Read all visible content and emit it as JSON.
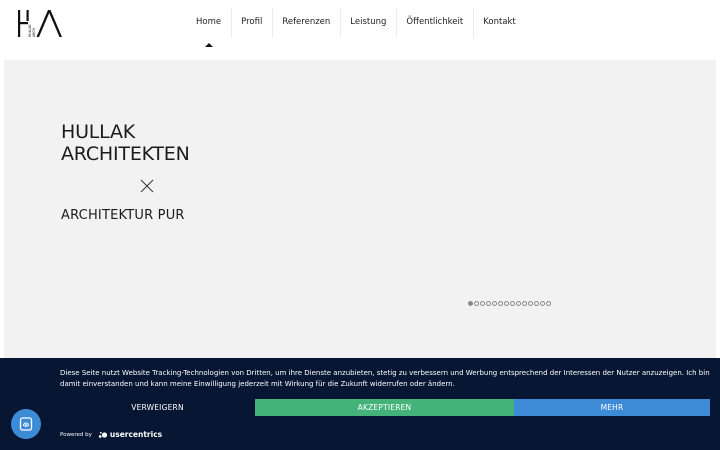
{
  "header": {
    "logo_text": "HULLAK ARCHITEKTEN",
    "nav": [
      {
        "label": "Home",
        "active": true
      },
      {
        "label": "Profil"
      },
      {
        "label": "Referenzen"
      },
      {
        "label": "Leistung"
      },
      {
        "label": "Öffentlichkeit"
      },
      {
        "label": "Kontakt"
      }
    ]
  },
  "hero": {
    "title_line1": "HULLAK",
    "title_line2": "ARCHITEKTEN",
    "subtitle": "ARCHITEKTUR PUR",
    "slide_count": 14,
    "active_slide": 0,
    "background": "#f3f2f2"
  },
  "cookie_banner": {
    "text": "Diese Seite nutzt Website Tracking-Technologien von Dritten, um ihre Dienste anzubieten, stetig zu verbessern und Werbung entsprechend der Interessen der Nutzer anzuzeigen. Ich bin damit einverstanden und kann meine Einwilligung jederzeit mit Wirkung für die Zukunft widerrufen oder ändern.",
    "deny_label": "VERWEIGERN",
    "accept_label": "AKZEPTIEREN",
    "more_label": "MEHR",
    "powered_by": "Powered by",
    "brand": "usercentrics",
    "colors": {
      "background": "#071633",
      "accept": "#45b379",
      "more": "#3d8ad6"
    }
  },
  "privacy_button": {
    "icon": "fingerprint-icon"
  }
}
